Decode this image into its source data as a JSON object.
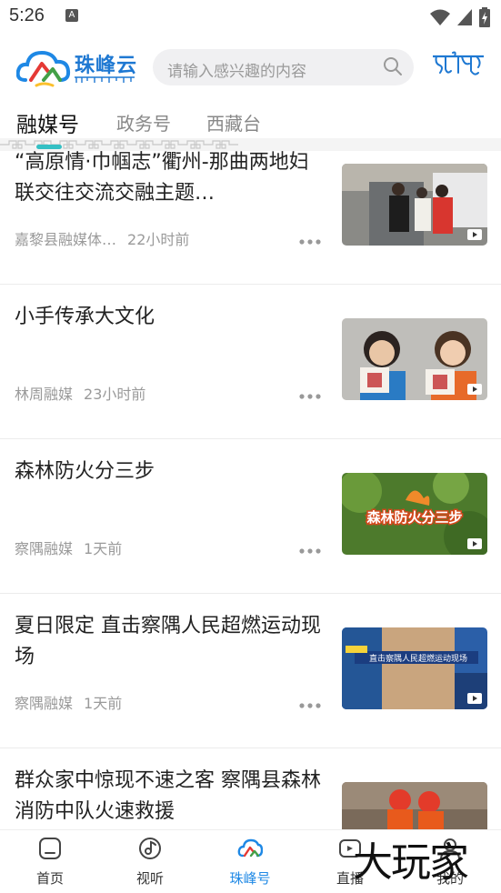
{
  "status_bar": {
    "time": "5:26",
    "a_icon": "A"
  },
  "header": {
    "app_name": "珠峰云",
    "search_placeholder": "请输入感兴趣的内容"
  },
  "tabs": [
    {
      "label": "融媒号",
      "active": true
    },
    {
      "label": "政务号",
      "active": false
    },
    {
      "label": "西藏台",
      "active": false
    }
  ],
  "feed": [
    {
      "title": "“高原情·巾帼志”衢州-那曲两地妇联交往交流交融主题…",
      "source": "嘉黎县融媒体…",
      "time": "22小时前",
      "thumb_overlay": ""
    },
    {
      "title": "小手传承大文化",
      "source": "林周融媒",
      "time": "23小时前",
      "thumb_overlay": ""
    },
    {
      "title": "森林防火分三步",
      "source": "察隅融媒",
      "time": "1天前",
      "thumb_overlay": "森林防火分三步"
    },
    {
      "title": "夏日限定 直击察隅人民超燃运动现场",
      "source": "察隅融媒",
      "time": "1天前",
      "thumb_overlay": "直击察隅人民超燃运动现场"
    },
    {
      "title": "群众家中惊现不速之客 察隅县森林消防中队火速救援",
      "source": "",
      "time": "",
      "thumb_overlay": ""
    }
  ],
  "bottom_nav": [
    {
      "label": "首页",
      "icon": "home-icon",
      "active": false
    },
    {
      "label": "视听",
      "icon": "music-note-icon",
      "active": false
    },
    {
      "label": "珠峰号",
      "icon": "cloud-logo-icon",
      "active": true
    },
    {
      "label": "直播",
      "icon": "tv-icon",
      "active": false
    },
    {
      "label": "我的",
      "icon": "person-icon",
      "active": false
    }
  ],
  "watermark": "大玩家",
  "colors": {
    "accent": "#1e88e5",
    "indicator": "#35c0c4",
    "search_bg": "#f0f0f2"
  }
}
